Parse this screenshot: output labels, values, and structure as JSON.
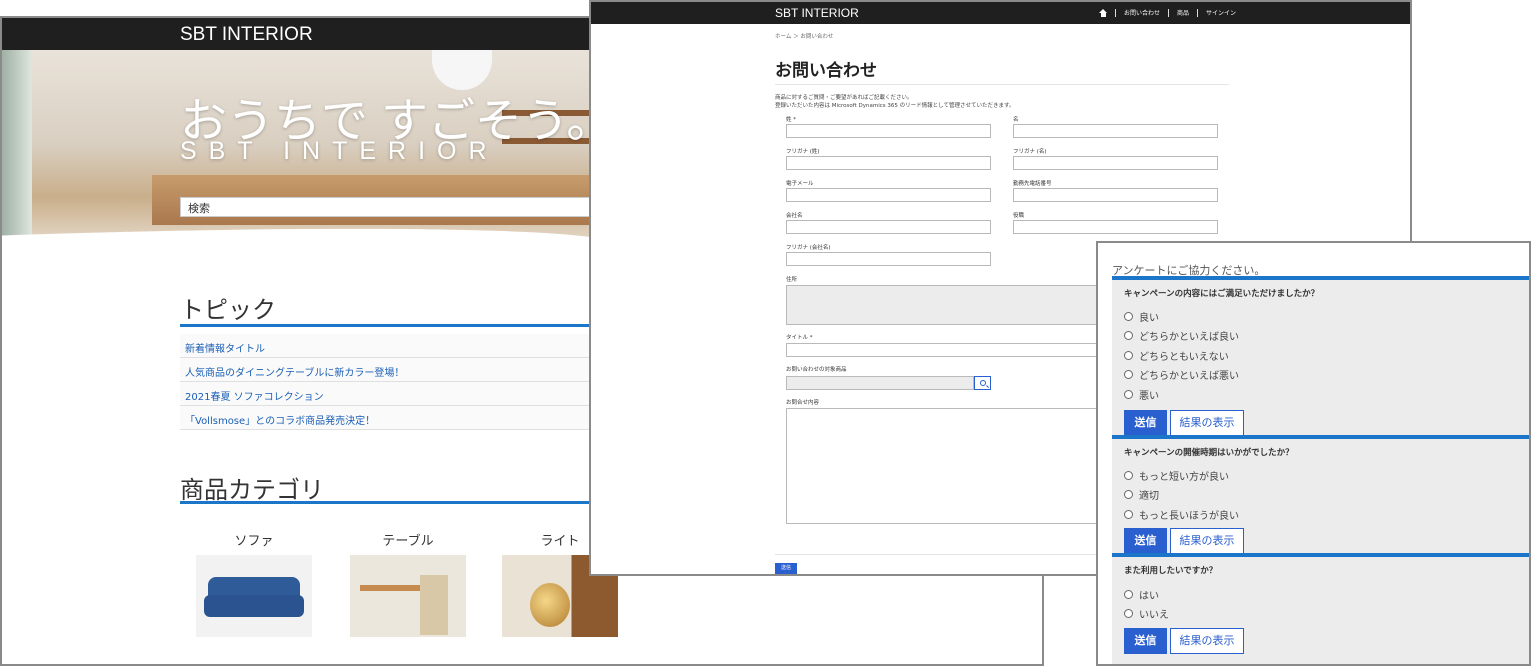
{
  "portal": {
    "brand": "SBT INTERIOR",
    "hero_headline": "おうちで すごそう。",
    "hero_subhead": "SBT INTERIOR",
    "search_placeholder": "検索",
    "topics_title": "トピック",
    "topics": [
      "新着情報タイトル",
      "人気商品のダイニングテーブルに新カラー登場！",
      "2021春夏 ソファコレクション",
      "「Vollsmose」とのコラボ商品発売決定！"
    ],
    "categories_title": "商品カテゴリ",
    "categories": [
      "ソファ",
      "テーブル",
      "ライト"
    ],
    "colors": {
      "accent": "#1b75c9",
      "topbar": "#1f1f1f"
    }
  },
  "contact": {
    "brand": "SBT INTERIOR",
    "nav": [
      "お問い合わせ",
      "商品",
      "サインイン"
    ],
    "breadcrumb": "ホーム ＞ お問い合わせ",
    "title": "お問い合わせ",
    "description_line1": "商品に対するご質問・ご要望があればご記載ください。",
    "description_line2": "登録いただいた内容は Microsoft Dynamics 365 のリード情報として管理させていただきます。",
    "fields": {
      "last_name": "姓 *",
      "first_name": "名",
      "kana_last": "フリガナ (姓)",
      "kana_first": "フリガナ (名)",
      "email": "電子メール",
      "work_phone": "勤務先電話番号",
      "company": "会社名",
      "job_title": "役職",
      "kana_company": "フリガナ (会社名)",
      "address": "住所",
      "subject": "タイトル *",
      "product": "お問い合わせの対象商品",
      "details": "お問合せ内容"
    },
    "submit_label": "送信"
  },
  "survey": {
    "intro": "アンケートにご協力ください。",
    "questions": [
      {
        "title": "キャンペーンの内容にはご満足いただけましたか？",
        "options": [
          "良い",
          "どちらかといえば良い",
          "どちらともいえない",
          "どちらかといえば悪い",
          "悪い"
        ]
      },
      {
        "title": "キャンペーンの開催時期はいかがでしたか？",
        "options": [
          "もっと短い方が良い",
          "適切",
          "もっと長いほうが良い"
        ]
      },
      {
        "title": "また利用したいですか？",
        "options": [
          "はい",
          "いいえ"
        ]
      }
    ],
    "send_label": "送信",
    "results_label": "結果の表示",
    "colors": {
      "button": "#2a5fd0",
      "rule": "#1b75c9"
    }
  }
}
